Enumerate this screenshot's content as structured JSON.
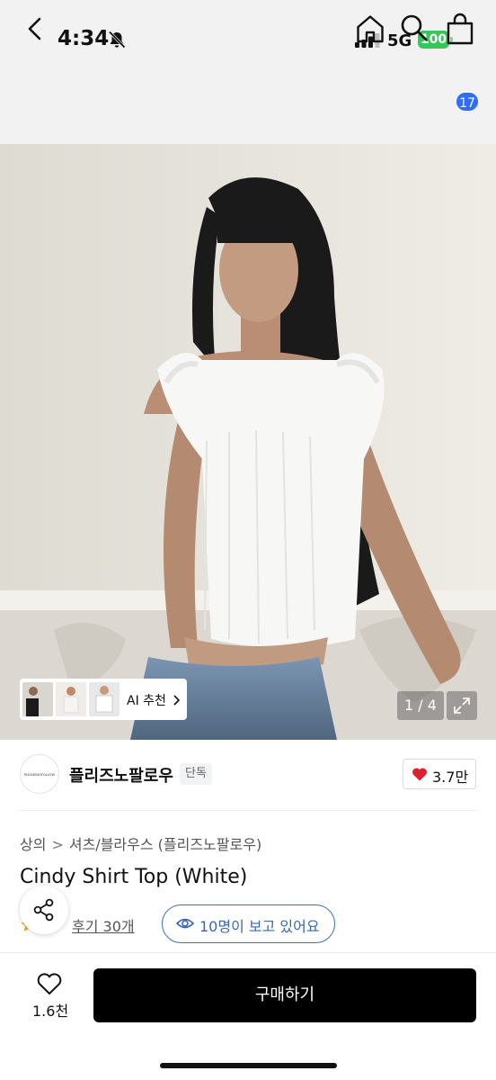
{
  "status_bar": {
    "time": "4:34",
    "network": "5G",
    "battery": "100",
    "icons": [
      "bell-off-icon",
      "signal-icon",
      "battery-icon"
    ]
  },
  "header": {
    "icons": [
      "back-icon",
      "home-icon",
      "search-icon",
      "shopping-bag-icon"
    ],
    "cart_count": "17"
  },
  "gallery": {
    "ai_recommend_label": "AI 추천",
    "page_indicator": "1 / 4",
    "expand_icon": "expand-icon"
  },
  "brand": {
    "logo_text": "PLEASENOFOLLOW",
    "name": "플리즈노팔로우",
    "tag": "단독",
    "likes": "3.7만"
  },
  "product": {
    "breadcrumb": [
      "상의",
      "셔츠/블라우스 (플리즈노팔로우)"
    ],
    "title": "Cindy Shirt Top (White)",
    "reviews_label": "후기 30개",
    "viewers_label": "10명이 보고 있어요"
  },
  "bottom_bar": {
    "wish_count": "1.6천",
    "buy_label": "구매하기"
  },
  "colors": {
    "accent_blue": "#2f6df6",
    "viewers_blue": "#3a67b2",
    "heart_red": "#e0202e",
    "battery_green": "#34c759",
    "buy_black": "#000000"
  }
}
